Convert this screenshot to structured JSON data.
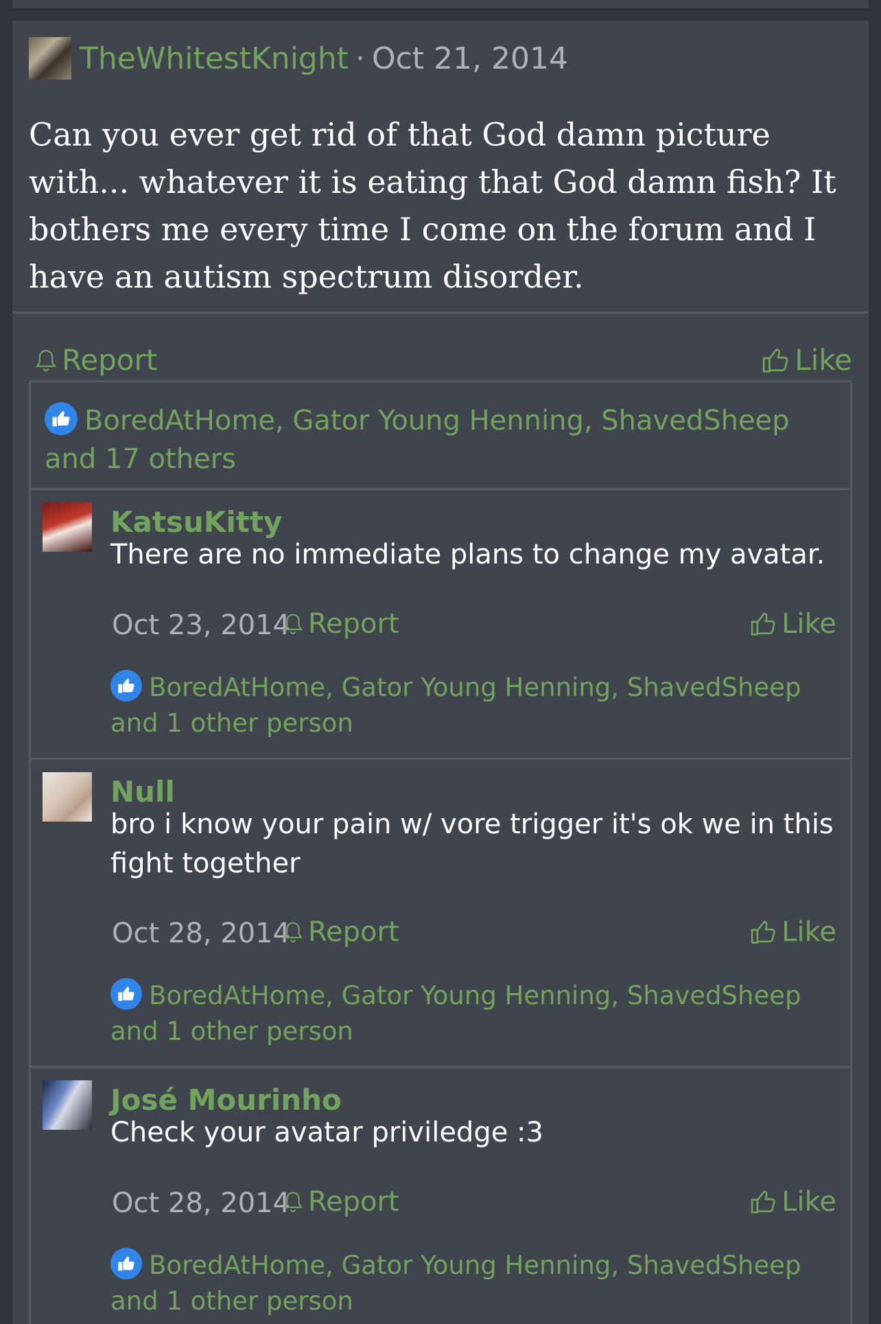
{
  "post": {
    "username": "TheWhitestKnight",
    "separator": "·",
    "date": "Oct 21, 2014",
    "body": "Can you ever get rid of that God damn picture with... whatever it is eating that God damn fish? It bothers me every time I come on the forum and I have an autism spectrum disorder.",
    "report_label": "Report",
    "like_label": "Like",
    "likes_summary": "BoredAtHome, Gator Young Henning, ShavedSheep and 17 others"
  },
  "comments": [
    {
      "username": "KatsuKitty",
      "text": "There are no immediate plans to change my avatar.",
      "date": "Oct 23, 2014",
      "report_label": "Report",
      "like_label": "Like",
      "likes_summary": "BoredAtHome, Gator Young Henning, ShavedSheep and 1 other person"
    },
    {
      "username": "Null",
      "text": "bro i know your pain w/ vore trigger it's ok we in this fight together",
      "date": "Oct 28, 2014",
      "report_label": "Report",
      "like_label": "Like",
      "likes_summary": "BoredAtHome, Gator Young Henning, ShavedSheep and 1 other person"
    },
    {
      "username": "José Mourinho",
      "text": "Check your avatar priviledge :3",
      "date": "Oct 28, 2014",
      "report_label": "Report",
      "like_label": "Like",
      "likes_summary": "BoredAtHome, Gator Young Henning, ShavedSheep and 1 other person"
    }
  ],
  "colors": {
    "page_background": "#2f333a",
    "panel_background": "#40444c",
    "accent_green": "#71a35f",
    "like_badge_blue": "#2f86e8",
    "date_gray": "#aeb2b8",
    "divider": "#555a62"
  },
  "icons": {
    "report": "bell-icon",
    "like": "thumbs-up-icon",
    "likes_badge": "thumbs-up-badge-icon"
  }
}
